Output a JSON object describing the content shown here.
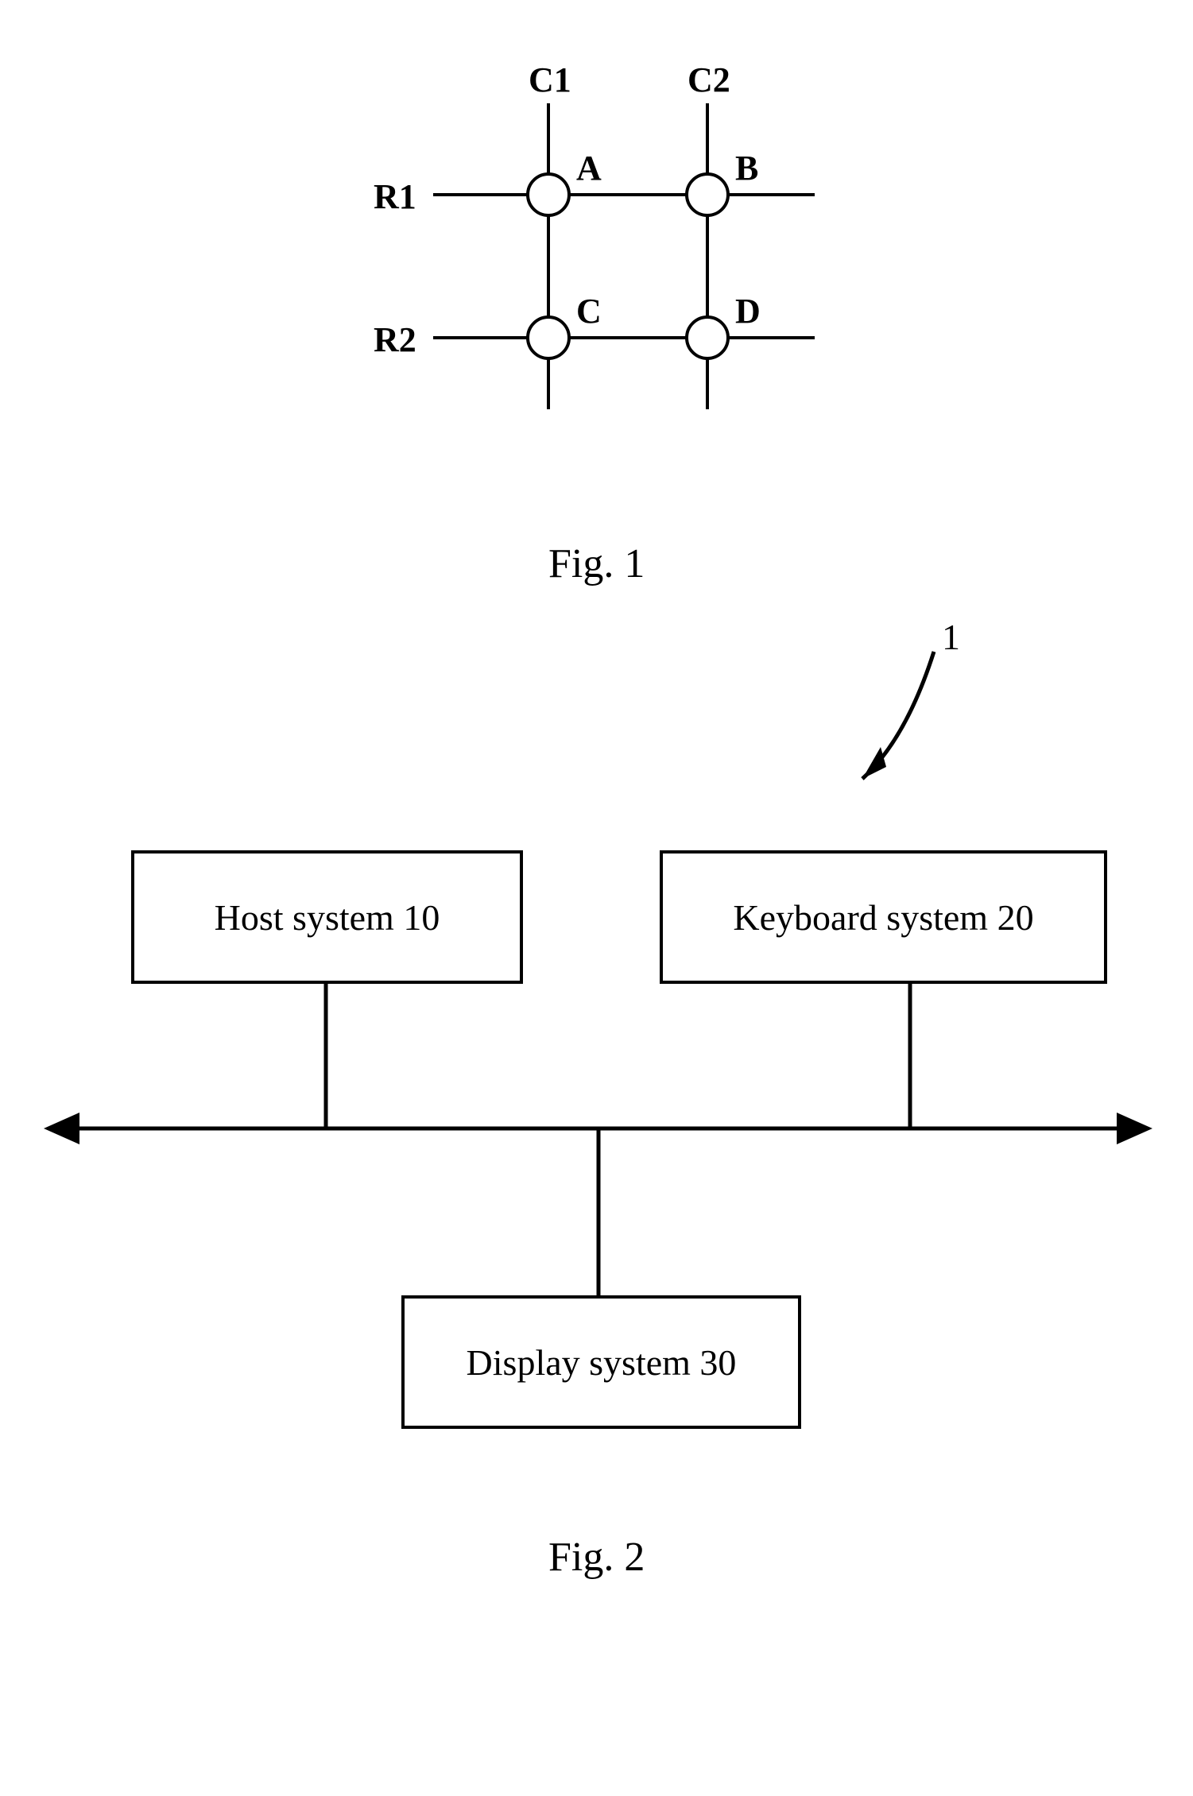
{
  "fig1": {
    "caption": "Fig. 1",
    "columns": {
      "c1": "C1",
      "c2": "C2"
    },
    "rows": {
      "r1": "R1",
      "r2": "R2"
    },
    "nodes": {
      "a": "A",
      "b": "B",
      "c": "C",
      "d": "D"
    }
  },
  "fig2": {
    "caption": "Fig. 2",
    "arrow_ref": "1",
    "boxes": {
      "host": "Host system 10",
      "keyboard": "Keyboard system 20",
      "display": "Display system 30"
    }
  }
}
